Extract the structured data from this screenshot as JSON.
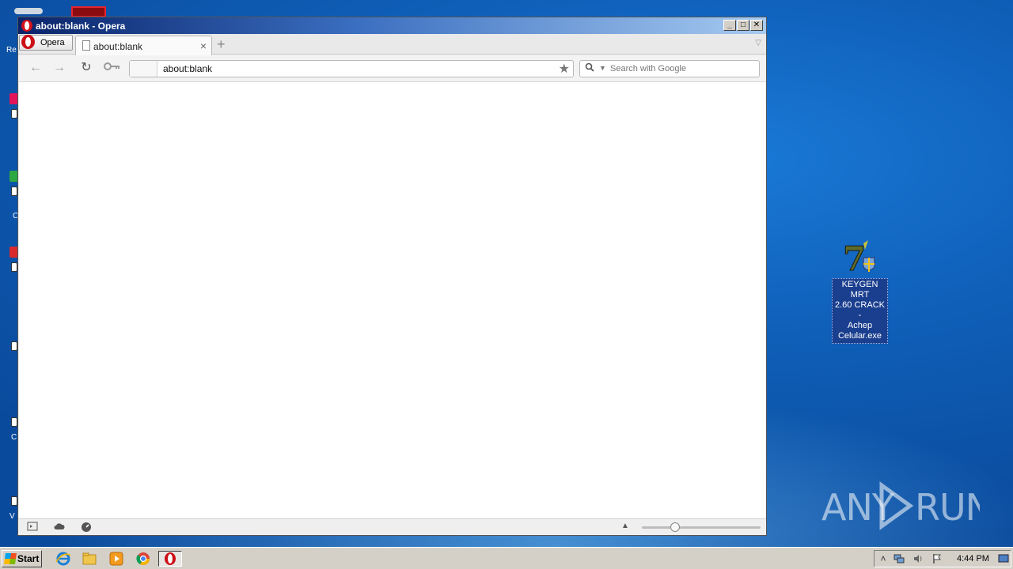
{
  "window": {
    "title": "about:blank - Opera",
    "menu_label": "Opera",
    "controls": {
      "minimize": "_",
      "maximize": "□",
      "close": "✕"
    }
  },
  "tabs": [
    {
      "label": "about:blank",
      "close": "×"
    }
  ],
  "new_tab_symbol": "+",
  "toolbar": {
    "address_value": "about:blank",
    "search_placeholder": "Search with Google",
    "icons": [
      "back-icon",
      "forward-icon",
      "reload-icon",
      "key-icon",
      "star-icon",
      "search-icon"
    ]
  },
  "desktop": {
    "partial_labels": [
      "Re",
      "C",
      "C",
      "V"
    ],
    "keygen_icon_label": "KEYGEN MRT\n2.60 CRACK -\nAchep\nCelular.exe",
    "watermark": "ANY RUN"
  },
  "taskbar": {
    "start_label": "Start",
    "clock": "4:44 PM",
    "pinned": [
      "ie-icon",
      "explorer-icon",
      "media-player-icon",
      "chrome-icon",
      "opera-icon"
    ]
  },
  "colors": {
    "titlebar_start": "#0a246a",
    "titlebar_end": "#a6caf0",
    "desktop_blue": "#1565c0",
    "opera_red": "#cc0f16"
  }
}
